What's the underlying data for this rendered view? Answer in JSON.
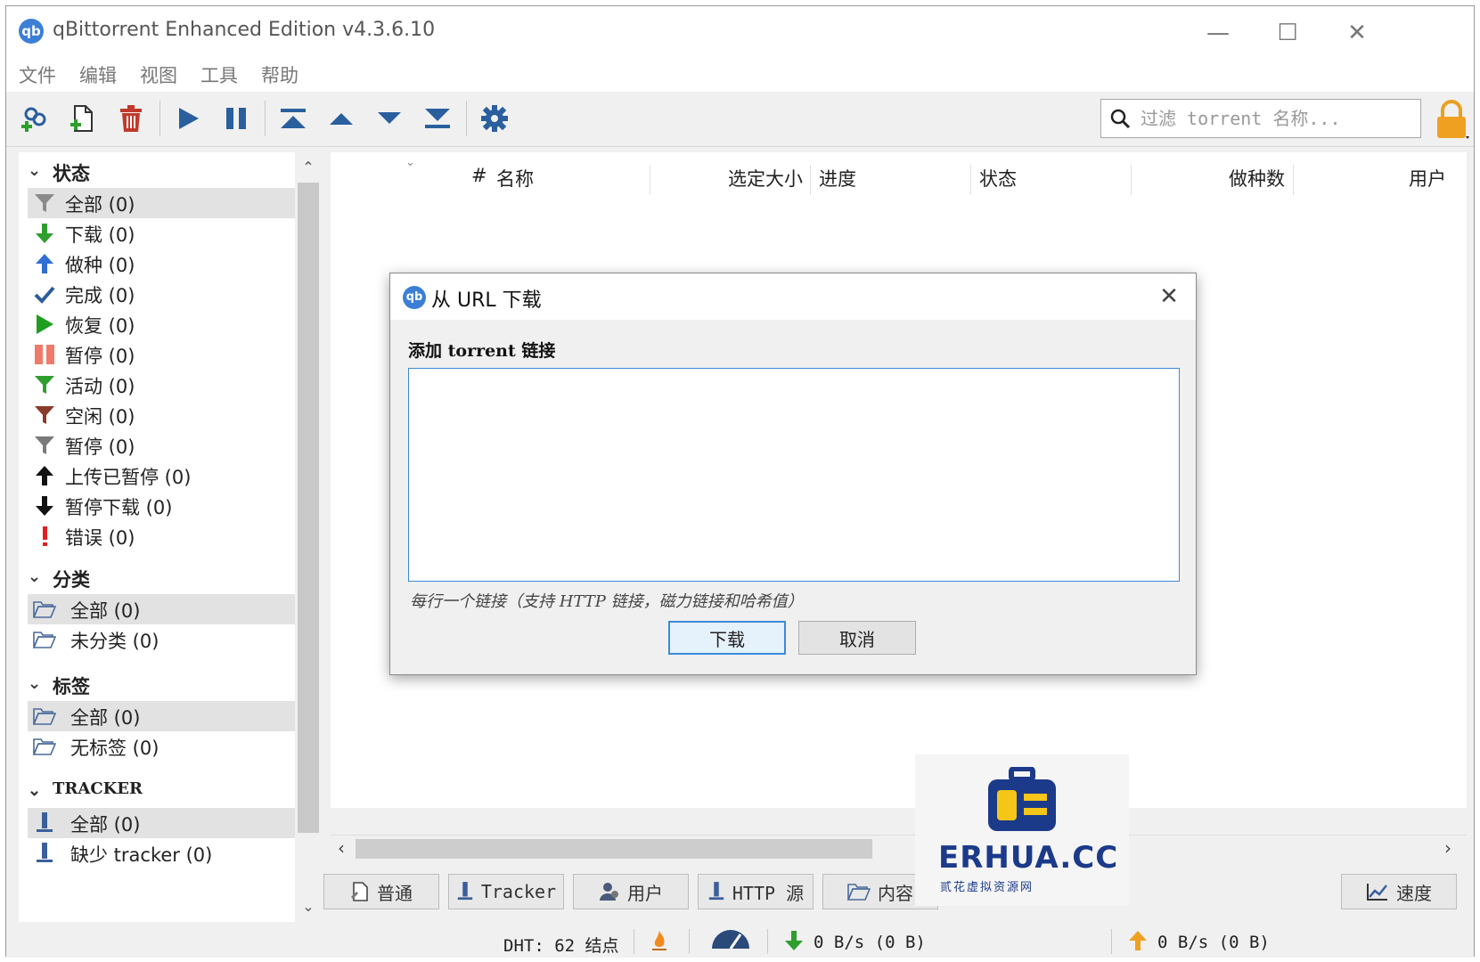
{
  "window": {
    "title": "qBittorrent Enhanced Edition v4.3.6.10",
    "logo_text": "qb",
    "minimize": "—",
    "maximize": "☐",
    "close": "✕"
  },
  "menu": [
    "文件",
    "编辑",
    "视图",
    "工具",
    "帮助"
  ],
  "search": {
    "placeholder": "过滤 torrent 名称..."
  },
  "sidebar": {
    "status_header": "状态",
    "status_items": [
      {
        "label": "全部 (0)",
        "icon": "filter-icon",
        "color": "#8a8a8a"
      },
      {
        "label": "下载 (0)",
        "icon": "download-arrow-icon",
        "color": "#2e9e2e"
      },
      {
        "label": "做种 (0)",
        "icon": "upload-arrow-icon",
        "color": "#2f6fd6"
      },
      {
        "label": "完成 (0)",
        "icon": "checkmark-icon",
        "color": "#2e5c9a"
      },
      {
        "label": "恢复 (0)",
        "icon": "play-icon",
        "color": "#1f9e1f"
      },
      {
        "label": "暂停 (0)",
        "icon": "pause-icon",
        "color": "#f07a6a"
      },
      {
        "label": "活动 (0)",
        "icon": "filter-active-icon",
        "color": "#2e9e2e"
      },
      {
        "label": "空闲 (0)",
        "icon": "filter-inactive-icon",
        "color": "#8a3a2a"
      },
      {
        "label": "暂停 (0)",
        "icon": "filter-stalled-icon",
        "color": "#7a7a7a"
      },
      {
        "label": "上传已暂停 (0)",
        "icon": "upload-paused-icon",
        "color": "#111111"
      },
      {
        "label": "暂停下载 (0)",
        "icon": "download-paused-icon",
        "color": "#111111"
      },
      {
        "label": "错误 (0)",
        "icon": "error-icon",
        "color": "#e02020"
      }
    ],
    "category_header": "分类",
    "category_items": [
      "全部 (0)",
      "未分类 (0)"
    ],
    "tag_header": "标签",
    "tag_items": [
      "全部 (0)",
      "无标签 (0)"
    ],
    "tracker_header": "TRACKER",
    "tracker_items": [
      "全部 (0)",
      "缺少 tracker (0)"
    ]
  },
  "table": {
    "columns": [
      "#",
      "名称",
      "选定大小",
      "进度",
      "状态",
      "做种数",
      "用户"
    ]
  },
  "bottom_tabs": [
    "普通",
    "Tracker",
    "用户",
    "HTTP 源",
    "内容",
    "速度"
  ],
  "statusbar": {
    "dht": "DHT: 62 结点",
    "download": "0 B/s (0 B)",
    "upload": "0 B/s (0 B)"
  },
  "dialog": {
    "title": "从 URL 下载",
    "label": "添加 torrent 链接",
    "textarea_value": "",
    "hint": "每行一个链接（支持 HTTP 链接，磁力链接和哈希值）",
    "download_btn": "下载",
    "cancel_btn": "取消"
  },
  "watermark": {
    "brand": "ERHUA.CC",
    "sub": "贰花虚拟资源网"
  },
  "colors": {
    "accent": "#3c8ad8",
    "logo_blue": "#3c7fd6",
    "lock": "#f0a020"
  }
}
